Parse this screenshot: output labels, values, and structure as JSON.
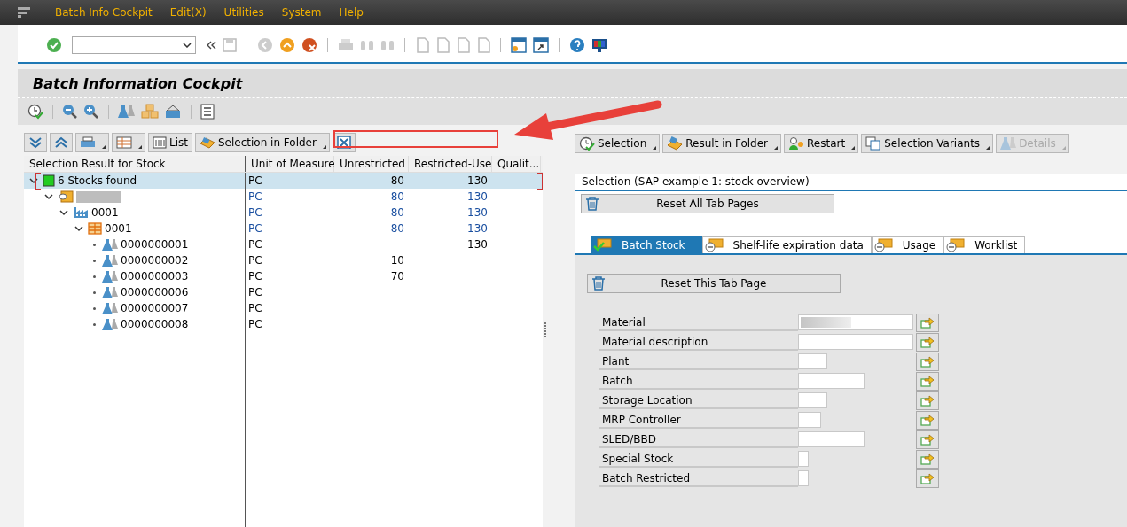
{
  "menu": [
    {
      "label": "Batch Info Cockpit"
    },
    {
      "label": "Edit(X)"
    },
    {
      "label": "Utilities"
    },
    {
      "label": "System"
    },
    {
      "label": "Help"
    }
  ],
  "title": "Batch Information Cockpit",
  "left_toolbar": [
    {
      "label": "List",
      "has_menu": false
    },
    {
      "label": "Selection in Folder",
      "has_menu": true
    }
  ],
  "tree": {
    "columns": [
      "Selection Result for Stock",
      "Unit of Measure",
      "Unrestricted",
      "Restricted-Use",
      "Qualit..."
    ],
    "nodes": [
      {
        "kind": "root",
        "label": "6 Stocks found",
        "expanded": true,
        "selected": true,
        "uom": "PC",
        "unrestricted": "80",
        "restricted": "130",
        "children": [
          {
            "kind": "material",
            "redacted": true,
            "expanded": true,
            "selected": false,
            "uom": "PC",
            "unrestricted": "80",
            "restricted": "130",
            "children": [
              {
                "kind": "plant",
                "label": "0001",
                "expanded": true,
                "selected": false,
                "uom": "PC",
                "unrestricted": "80",
                "restricted": "130",
                "children": [
                  {
                    "kind": "storage",
                    "label": "0001",
                    "expanded": true,
                    "selected": false,
                    "uom": "PC",
                    "unrestricted": "80",
                    "restricted": "130",
                    "children": [
                      {
                        "kind": "batch",
                        "label": "0000000001",
                        "selected": false,
                        "uom": "PC",
                        "restricted": "130"
                      },
                      {
                        "kind": "batch",
                        "label": "0000000002",
                        "selected": false,
                        "uom": "PC",
                        "unrestricted": "10"
                      },
                      {
                        "kind": "batch",
                        "label": "0000000003",
                        "selected": false,
                        "uom": "PC",
                        "unrestricted": "70"
                      },
                      {
                        "kind": "batch",
                        "label": "0000000006",
                        "selected": false,
                        "uom": "PC"
                      },
                      {
                        "kind": "batch",
                        "label": "0000000007",
                        "selected": false,
                        "uom": "PC"
                      },
                      {
                        "kind": "batch",
                        "label": "0000000008",
                        "selected": false,
                        "uom": "PC"
                      }
                    ]
                  }
                ]
              }
            ]
          }
        ]
      }
    ]
  },
  "right_toolbar": [
    {
      "kind": "selection",
      "label": "Selection",
      "disabled": false
    },
    {
      "kind": "folder",
      "label": "Result in Folder",
      "disabled": false
    },
    {
      "kind": "restart",
      "label": "Restart",
      "disabled": false
    },
    {
      "kind": "variants",
      "label": "Selection Variants",
      "disabled": false
    },
    {
      "kind": "details",
      "label": "Details",
      "disabled": true
    }
  ],
  "selection": {
    "heading": "Selection (SAP example 1: stock overview)",
    "reset_all": "Reset All Tab Pages",
    "tabs": [
      {
        "label": "Batch Stock",
        "selected": true
      },
      {
        "label": "Shelf-life expiration data",
        "selected": false
      },
      {
        "label": "Usage",
        "selected": false
      },
      {
        "label": "Worklist",
        "selected": false
      }
    ],
    "reset_tab": "Reset This Tab Page",
    "fields": [
      {
        "label": "Material",
        "redacted": true
      },
      {
        "label": "Material description"
      },
      {
        "label": "Plant"
      },
      {
        "label": "Batch"
      },
      {
        "label": "Storage Location"
      },
      {
        "label": "MRP Controller"
      },
      {
        "label": "SLED/BBD"
      },
      {
        "label": "Special Stock"
      },
      {
        "label": "Batch Restricted"
      }
    ]
  }
}
